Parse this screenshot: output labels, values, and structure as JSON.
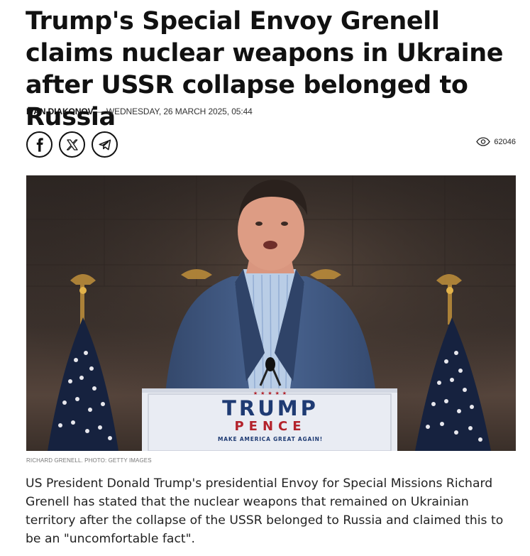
{
  "article": {
    "headline": "Trump's Special Envoy Grenell claims nuclear weapons in Ukraine after USSR collapse belonged to Russia",
    "author": "IVAN DIAKONOV",
    "separator": " — ",
    "date": "WEDNESDAY, 26 MARCH 2025, 05:44",
    "views": "62046",
    "image_caption": "RICHARD GRENELL. PHOTO: GETTY IMAGES",
    "lead": "US President Donald Trump's presidential Envoy for Special Missions Richard Grenell has stated that the nuclear weapons that remained on Ukrainian territory after the collapse of the USSR belonged to Russia and claimed this to be an \"uncomfortable fact\"."
  },
  "share": [
    {
      "icon": "facebook-icon"
    },
    {
      "icon": "x-icon"
    },
    {
      "icon": "telegram-icon"
    }
  ],
  "photo": {
    "podium_line1": "TRUMP",
    "podium_line2": "PENCE",
    "podium_line3": "MAKE AMERICA GREAT AGAIN!",
    "podium_stars": "★ ★ ★ ★ ★"
  },
  "colors": {
    "podium_blue": "#1f3b73",
    "podium_red": "#b3222b",
    "text": "#111111"
  }
}
